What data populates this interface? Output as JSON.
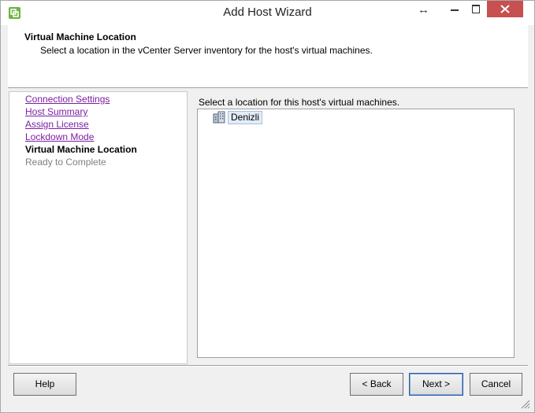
{
  "window": {
    "title": "Add Host Wizard",
    "resize_glyph": "↔"
  },
  "header": {
    "title": "Virtual Machine Location",
    "description": "Select a location in the vCenter Server inventory for the host's virtual machines."
  },
  "steps": [
    {
      "label": "Connection Settings",
      "state": "link"
    },
    {
      "label": "Host Summary",
      "state": "link"
    },
    {
      "label": "Assign License",
      "state": "link"
    },
    {
      "label": "Lockdown Mode",
      "state": "link"
    },
    {
      "label": "Virtual Machine Location",
      "state": "current"
    },
    {
      "label": "Ready to Complete",
      "state": "disabled"
    }
  ],
  "content": {
    "label": "Select a location for this host's virtual machines.",
    "tree": [
      {
        "label": "Denizli",
        "icon": "datacenter-icon",
        "selected": true
      }
    ]
  },
  "buttons": {
    "help": "Help",
    "back": "< Back",
    "next": "Next >",
    "cancel": "Cancel"
  },
  "colors": {
    "link": "#7b1fa2",
    "close": "#c75050",
    "selection": "#e3ecf7"
  }
}
